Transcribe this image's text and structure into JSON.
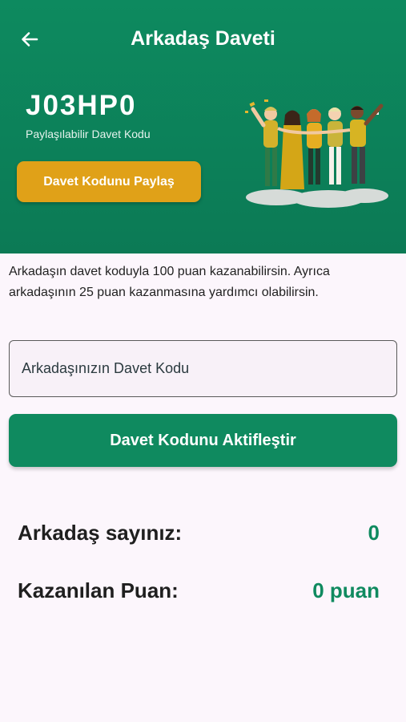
{
  "header": {
    "title": "Arkadaş Daveti",
    "back_icon": "arrow-left-icon",
    "invite_code": "J03HP0",
    "invite_code_caption": "Paylaşılabilir Davet Kodu",
    "share_button_label": "Davet Kodunu Paylaş",
    "illustration": "group-of-friends-illustration"
  },
  "info_text": "Arkadaşın davet koduyla 100 puan kazanabilirsin. Ayrıca arkadaşının 25 puan kazanmasına yardımcı olabilirsin.",
  "friend_code_input": {
    "placeholder": "Arkadaşınızın Davet Kodu",
    "value": ""
  },
  "activate_button_label": "Davet Kodunu Aktifleştir",
  "stats": {
    "friend_count_label": "Arkadaş sayınız:",
    "friend_count_value": "0",
    "earned_points_label": "Kazanılan Puan:",
    "earned_points_value": "0 puan"
  },
  "colors": {
    "primary_green": "#0f8a5f",
    "accent_orange": "#e0a118",
    "background": "#fcf6fc"
  }
}
